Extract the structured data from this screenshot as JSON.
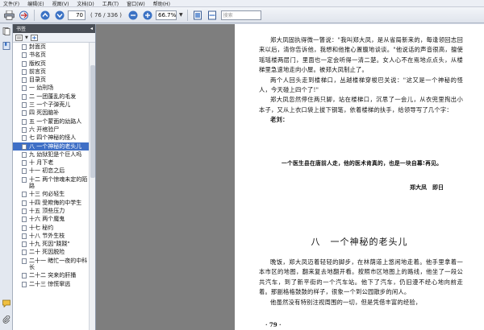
{
  "menu": [
    "文件(F)",
    "编辑(E)",
    "视图(V)",
    "文档(D)",
    "工具(T)",
    "窗口(W)",
    "帮助(H)"
  ],
  "toolbar": {
    "page_current": "70",
    "page_total": "( 76 / 336 )",
    "zoom": "66.7%",
    "search_placeholder": "搜索"
  },
  "bookmarks": {
    "panel_title": "书签",
    "items": [
      "封面页",
      "书名页",
      "版权页",
      "前言页",
      "目录页",
      "一 幼刑场",
      "二 一团蓬乱的毛发",
      "三 一个子弹壳儿",
      "四 死因脑补",
      "五 一个蒙面的幼路人",
      "六 开棺验尸",
      "七 四个神秘的怪人",
      "八 一个神秘的老头儿",
      "九 幼狱犯是个巨人吗",
      "十 月下老",
      "十一 初恋之后",
      "十二 两个惊魂未定的陌路",
      "十三 何必轻生",
      "十四 受欺侮的中学生",
      "十五 顶些压力",
      "十六 两个魔鬼",
      "十七 秘约",
      "十八 节外生枝",
      "十九 死因\"跷跷\"",
      "二十 死因脱险",
      "二十一 睹忙一夜的中科长",
      "二十二 突来的肝播",
      "二十三 惊慌窜逃"
    ],
    "selected_index": 12
  },
  "page": {
    "para1": "郑大凤固执得微一瞥说：\"我叫郑大凤，是从省局新来的，每逢领回志回来以后，清你告诉他，我想和他推心置腹地谈谈。\"他说话的声音很高，擅使瑶瑶楼两层门，里面也一定会听得一清二楚。女人心不在焉地点点头，从楼梯里急速地走向小屋。被郑大凤制止了。",
    "para2": "两个人回头走到楼梯口，丛越楼梯穿梭巴关说：\"这又是一个神秘的怪人，今天碰上四个了!\"",
    "para3": "郑大凤忽然停住两只脚，站在楼梯口，沉思了一会儿，从衣兜里掏出小本子，又从上衣口袋上拔下钢笔，依着楼梯的扶手，给领导写了几个字：",
    "quote_head": "老刘：",
    "quote_body": "一个医生县在唐前人走，他的医术肯真的，也是一块自幕!再见。",
    "signature": "郑大凤　即日",
    "chapter_title": "八　一个神秘的老头儿",
    "para4": "晚饭，郑大凤迈着轻轻的脚步，在林荫道上悠闲地走着。他手里拿着一本市区的地图，翻来复去地翻开看。按照市区地图上的路线，他坐了一段公共汽车，到了新平街的一个汽车站。他下了汽车，仍旧漫不经心地向前走着。那副格格鼓鼓的样子，很象一个到公园散步的闲人。",
    "para5": "他虽然没有特别注视周围的一切，但是凭借丰富的经验，",
    "page_number": "· 79 ·"
  }
}
